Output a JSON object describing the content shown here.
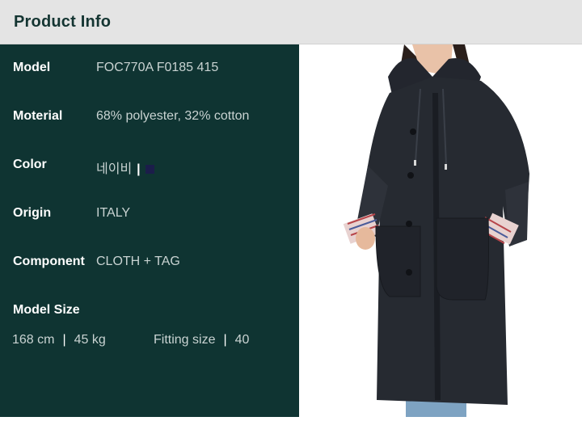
{
  "header": {
    "title": "Product Info"
  },
  "info": [
    {
      "label": "Model",
      "value": "FOC770A F0185 415"
    },
    {
      "label": "Moterial",
      "value": "68% polyester, 32% cotton"
    },
    {
      "label": "Color",
      "value": "네이비"
    },
    {
      "label": "Origin",
      "value": "ITALY"
    },
    {
      "label": "Component",
      "value": "CLOTH + TAG"
    }
  ],
  "color_swatch": "#1b1d4a",
  "model_size": {
    "label": "Model Size",
    "height": "168 cm",
    "weight": "45 kg",
    "fitting_label": "Fitting size",
    "fitting_value": "40"
  },
  "photo": {
    "subject": "long navy hooded coat with striped cuffs"
  }
}
